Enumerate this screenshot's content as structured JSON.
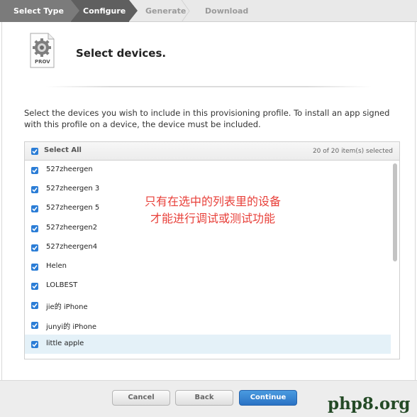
{
  "steps": [
    {
      "label": "Select Type",
      "state": "done"
    },
    {
      "label": "Configure",
      "state": "active"
    },
    {
      "label": "Generate",
      "state": "pending"
    },
    {
      "label": "Download",
      "state": "pending"
    }
  ],
  "header": {
    "icon_label": "PROV",
    "title": "Select devices."
  },
  "instructions": "Select the devices you wish to include in this provisioning profile. To install an app signed with this profile on a device, the device must be included.",
  "devices_table": {
    "select_all_label": "Select All",
    "select_all_checked": true,
    "selection_count": "20 of 20 item(s) selected",
    "rows": [
      {
        "name": "527zheergen",
        "checked": true
      },
      {
        "name": "527zheergen 3",
        "checked": true
      },
      {
        "name": "527zheergen 5",
        "checked": true
      },
      {
        "name": "527zheergen2",
        "checked": true
      },
      {
        "name": "527zheergen4",
        "checked": true
      },
      {
        "name": "Helen",
        "checked": true
      },
      {
        "name": "LOLBEST",
        "checked": true
      },
      {
        "name": "jie的 iPhone",
        "checked": true
      },
      {
        "name": "junyi的 iPhone",
        "checked": true
      },
      {
        "name": "little apple",
        "checked": true
      }
    ]
  },
  "annotation": {
    "line1": "只有在选中的列表里的设备",
    "line2": "才能进行调试或测试功能"
  },
  "footer": {
    "cancel_label": "Cancel",
    "back_label": "Back",
    "continue_label": "Continue"
  },
  "watermark": "php8.org",
  "colors": {
    "accent": "#2b7dd6",
    "annotation": "#e8403a",
    "highlight_row": "#e4f1f8",
    "watermark": "#244a26"
  }
}
